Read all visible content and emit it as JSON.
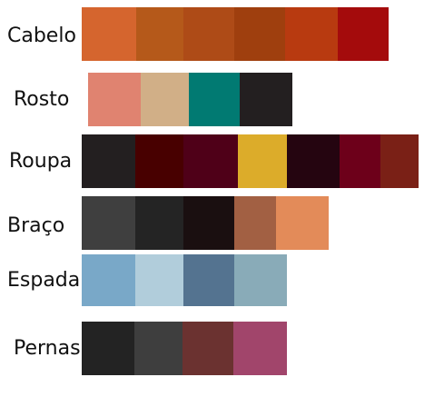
{
  "rows": [
    {
      "label": "Cabelo",
      "colors": [
        "#d5652e",
        "#b5591a",
        "#ae4b17",
        "#9f3f0e",
        "#b83a10",
        "#a40b0c"
      ]
    },
    {
      "label": "Rosto",
      "colors": [
        "#e08370",
        "#d1af87",
        "#017a72",
        "#231f20"
      ]
    },
    {
      "label": "Roupa",
      "colors": [
        "#231f20",
        "#480000",
        "#4f0018",
        "#dcac2a",
        "#250510",
        "#6d001a",
        "#7a2016"
      ]
    },
    {
      "label": "Braço",
      "colors": [
        "#3f3f3f",
        "#242424",
        "#1a0f10",
        "#a26043",
        "#e38b59"
      ]
    },
    {
      "label": "Espada",
      "colors": [
        "#79a8c8",
        "#b1cddb",
        "#547390",
        "#89abb8"
      ]
    },
    {
      "label": "Pernas",
      "colors": [
        "#232323",
        "#3e3e3e",
        "#6b3230",
        "#a1456b"
      ]
    }
  ]
}
